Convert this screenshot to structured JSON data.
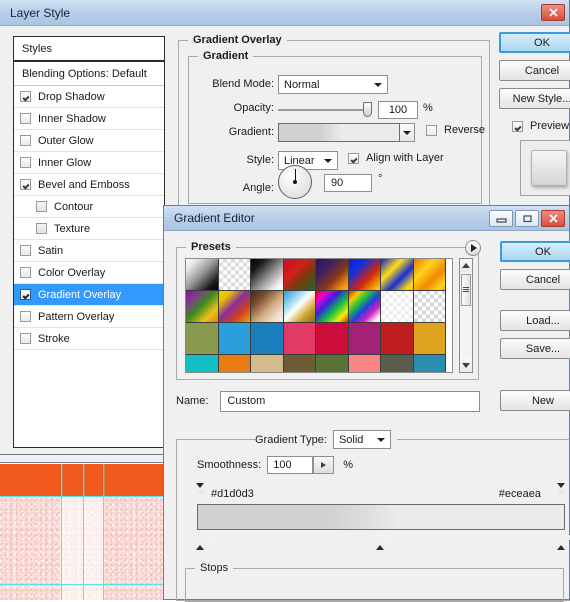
{
  "canvas_doc": {
    "band_orange_color": "#f1591c",
    "band_pink_color": "#f7dcd8",
    "guide_color": "#5ce1e6"
  },
  "layer_style": {
    "title": "Layer Style",
    "window_controls": [
      {
        "name": "close",
        "glyph": "close-icon"
      }
    ],
    "styles_panel": {
      "header": "Styles",
      "blending_options": "Blending Options: Default",
      "items": [
        {
          "label": "Drop Shadow",
          "checked": true,
          "sub": false,
          "selected": false
        },
        {
          "label": "Inner Shadow",
          "checked": false,
          "sub": false,
          "selected": false
        },
        {
          "label": "Outer Glow",
          "checked": false,
          "sub": false,
          "selected": false
        },
        {
          "label": "Inner Glow",
          "checked": false,
          "sub": false,
          "selected": false
        },
        {
          "label": "Bevel and Emboss",
          "checked": true,
          "sub": false,
          "selected": false
        },
        {
          "label": "Contour",
          "checked": false,
          "sub": true,
          "selected": false
        },
        {
          "label": "Texture",
          "checked": false,
          "sub": true,
          "selected": false
        },
        {
          "label": "Satin",
          "checked": false,
          "sub": false,
          "selected": false
        },
        {
          "label": "Color Overlay",
          "checked": false,
          "sub": false,
          "selected": false
        },
        {
          "label": "Gradient Overlay",
          "checked": true,
          "sub": false,
          "selected": true
        },
        {
          "label": "Pattern Overlay",
          "checked": false,
          "sub": false,
          "selected": false
        },
        {
          "label": "Stroke",
          "checked": false,
          "sub": false,
          "selected": false
        }
      ],
      "selection_color": "#3399ff"
    },
    "gradient_overlay": {
      "section_title": "Gradient Overlay",
      "group_title": "Gradient",
      "blend_mode": {
        "label": "Blend Mode:",
        "value": "Normal"
      },
      "opacity": {
        "label": "Opacity:",
        "value": "100",
        "unit": "%",
        "percent": 100
      },
      "gradient": {
        "label": "Gradient:",
        "reverse_label": "Reverse",
        "reverse_checked": false
      },
      "style": {
        "label": "Style:",
        "value": "Linear",
        "align_label": "Align with Layer",
        "align_checked": true
      },
      "angle": {
        "label": "Angle:",
        "value": "90",
        "unit": "°",
        "degrees": 90
      }
    },
    "buttons": [
      {
        "label": "OK",
        "primary": true
      },
      {
        "label": "Cancel",
        "primary": false
      },
      {
        "label": "New Style...",
        "primary": false
      }
    ],
    "preview": {
      "label": "Preview",
      "checked": true
    }
  },
  "gradient_editor": {
    "title": "Gradient Editor",
    "window_controls": [
      {
        "name": "minimize",
        "glyph": "minimize-icon"
      },
      {
        "name": "maximize",
        "glyph": "maximize-icon"
      },
      {
        "name": "close",
        "glyph": "close-icon"
      }
    ],
    "presets": {
      "group_title": "Presets",
      "menu_button": "presets-menu-icon",
      "swatches": [
        [
          "linear-gradient(135deg,#ffffff 0%,#e8e8e8 18%,#9a9a9a 48%,#1a1a1a 82%,#000000 100%)",
          "repeating-conic-gradient(#ffffff 0% 25%, #dcdcdc 0% 50%) 0/8px 8px",
          "linear-gradient(135deg,#000000 0%,#1a1a1a 22%,#8f8f8f 55%,#f2f2f2 85%,#ffffff 100%)",
          "linear-gradient(135deg,#c5102a 0%,#d21f17 38%,#7a3a10 62%,#1d6b2a 100%)",
          "linear-gradient(135deg,#2a1650 0%,#3c1f63 28%,#8a3a18 62%,#f08a12 85%,#ffb21a 100%)",
          "linear-gradient(135deg,#0b1fd6 0%,#1030e0 28%,#d2240c 62%,#f0a000 86%,#ffd21a 100%)",
          "linear-gradient(135deg,#0b1fd6 0%,#ffe011 34%,#1530d8 62%,#ffd90f 88%,#f5c400 100%)",
          "linear-gradient(135deg,#f07a00 0%,#ffd21a 34%,#f08a00 64%,#ffd21a 88%,#f5a300 100%)"
        ],
        [
          "linear-gradient(135deg,#6b1f86 0%,#8a2f9c 18%,#3f8a1f 48%,#e8c21a 76%,#f07a00 100%)",
          "linear-gradient(135deg,#f0d400 0%,#e8c000 20%,#8a2f9c 46%,#d2401a 72%,#f5a300 100%)",
          "linear-gradient(135deg,#3a2a1a 0%,#7a5230 28%,#d2a97e 56%,#f2e0d0 82%,#fdf5ef 100%)",
          "linear-gradient(135deg,#2f9ad6 0%,#8fd2f0 26%,#ffffff 48%,#d2a832 72%,#8a6a1a 100%)",
          "linear-gradient(135deg,#f0000a 0%,#f000d2 18%,#3a20e0 38%,#10c040 60%,#f0f000 82%,#f02000 100%)",
          "linear-gradient(135deg,#f02000 0%,#f0d000 18%,#20c040 36%,#2040e0 54%,#d020c0 72%,#ffffff 92%)",
          "repeating-conic-gradient(#ffffff 0% 25%, #ececec 0% 50%) 0/8px 8px",
          "repeating-conic-gradient(#ffffff 0% 25%, #d8d8d8 0% 50%) 0/8px 8px"
        ],
        [
          "#889a4e",
          "#2b9fdb",
          "#1b7fbd",
          "#e23a64",
          "#cc0d3c",
          "#a32277",
          "#bd1f1f",
          "#e0a520"
        ],
        [
          "#12bfc4",
          "#e97b14",
          "#d3bb8e",
          "#6d5c33",
          "#5a7135",
          "#f98585",
          "#5a5c4c",
          "#2a8cae"
        ]
      ]
    },
    "name": {
      "label": "Name:",
      "value": "Custom"
    },
    "gradient_type": {
      "label": "Gradient Type:",
      "value": "Solid"
    },
    "smoothness": {
      "label": "Smoothness:",
      "value": "100",
      "unit": "%"
    },
    "gradient_strip": {
      "css": "linear-gradient(90deg,#d1d0d3 0%,#d1d0d3 36%,#eceaea 55%,#eceaea 100%)",
      "left_stop_label": "#d1d0d3",
      "right_stop_label": "#eceaea",
      "opacity_stop_positions": [
        0,
        100
      ],
      "color_stop_positions": [
        0,
        50,
        100
      ]
    },
    "stops": {
      "group_title": "Stops"
    },
    "buttons": [
      {
        "label": "OK",
        "primary": true
      },
      {
        "label": "Cancel",
        "primary": false
      },
      {
        "label": "Load...",
        "primary": false
      },
      {
        "label": "Save...",
        "primary": false
      },
      {
        "label": "New",
        "primary": false
      }
    ]
  }
}
